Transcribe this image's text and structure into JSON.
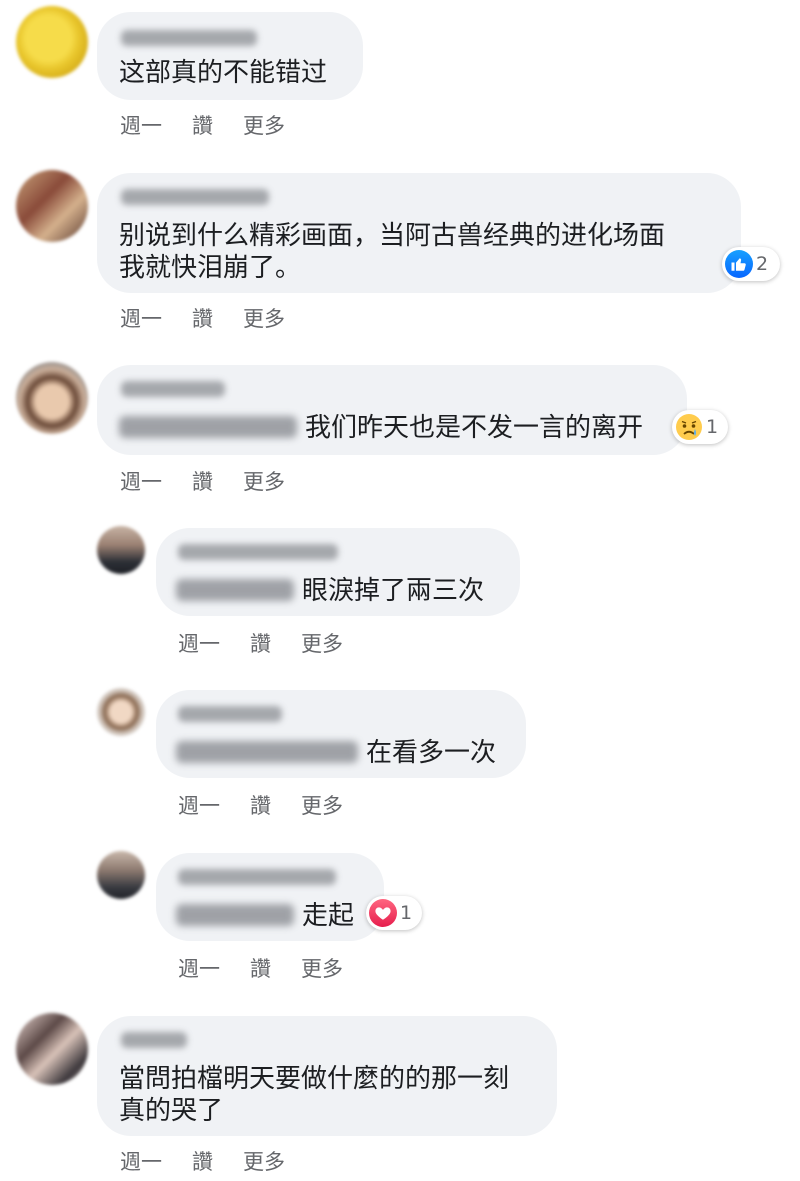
{
  "comments": [
    {
      "text_lines": [
        "这部真的不能错过"
      ],
      "actions": {
        "time": "週一",
        "like": "讚",
        "more": "更多"
      }
    },
    {
      "text_lines": [
        "别说到什么精彩画面，当阿古兽经典的进化场面",
        "我就快泪崩了。"
      ],
      "reaction_count": "2",
      "actions": {
        "time": "週一",
        "like": "讚",
        "more": "更多"
      }
    },
    {
      "text_lines": [
        "我们昨天也是不发一言的离开"
      ],
      "reaction_count": "1",
      "actions": {
        "time": "週一",
        "like": "讚",
        "more": "更多"
      }
    },
    {
      "text_lines": [
        "眼淚掉了兩三次"
      ],
      "actions": {
        "time": "週一",
        "like": "讚",
        "more": "更多"
      }
    },
    {
      "text_lines": [
        "在看多一次"
      ],
      "actions": {
        "time": "週一",
        "like": "讚",
        "more": "更多"
      }
    },
    {
      "text_lines": [
        "走起"
      ],
      "reaction_count": "1",
      "actions": {
        "time": "週一",
        "like": "讚",
        "more": "更多"
      }
    },
    {
      "text_lines": [
        "當問拍檔明天要做什麼的的那一刻",
        "真的哭了"
      ],
      "actions": {
        "time": "週一",
        "like": "讚",
        "more": "更多"
      }
    }
  ],
  "icons": {
    "like_reaction": "thumbs-up-icon",
    "sad_reaction": "crying-face-icon",
    "love_reaction": "heart-icon"
  },
  "colors": {
    "bubble": "#f0f2f5",
    "meta_text": "#65676b",
    "like_blue": "#0866ff",
    "love_red": "#e61e4d"
  }
}
